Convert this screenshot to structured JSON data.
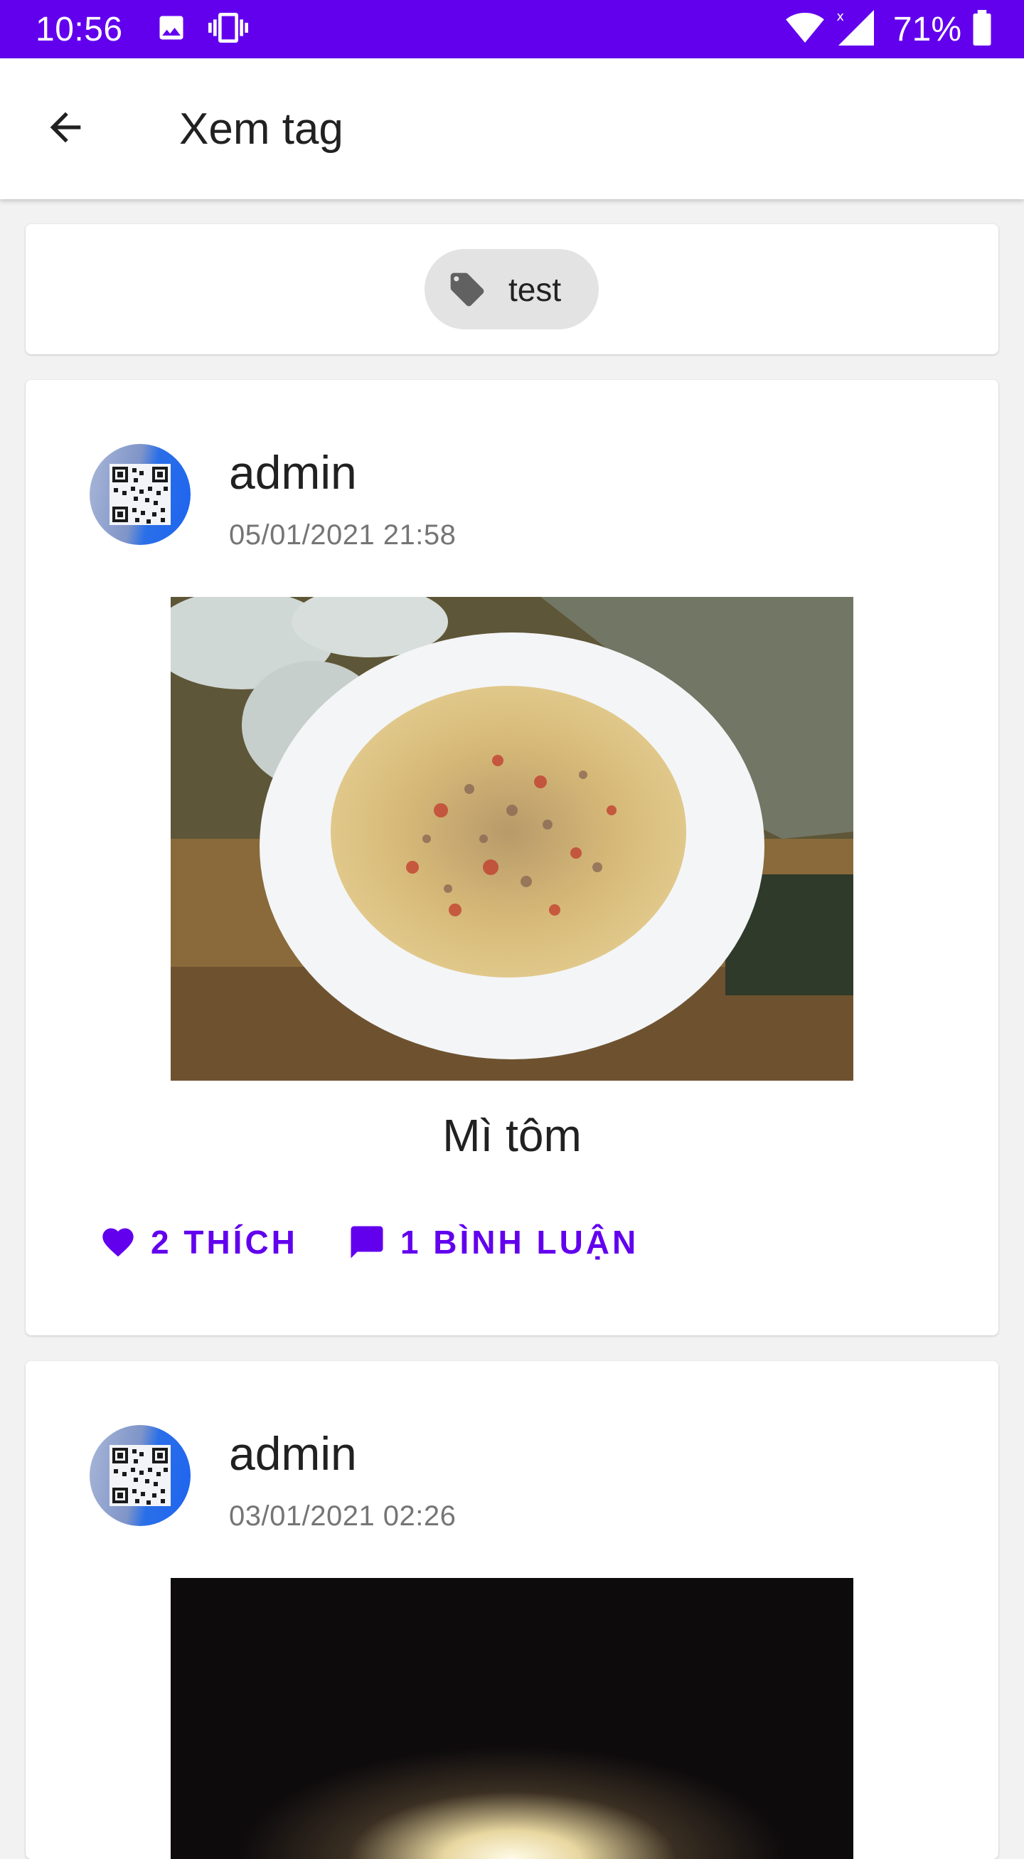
{
  "status_bar": {
    "time": "10:56",
    "battery": "71%",
    "background": "#6200ee",
    "icons": [
      "image-icon",
      "phone-vibrate-icon",
      "wifi-icon",
      "signal-icon",
      "battery-icon"
    ]
  },
  "app_bar": {
    "title": "Xem tag",
    "back_icon": "arrow-back-icon"
  },
  "tag": {
    "label": "test",
    "icon": "tag-icon"
  },
  "posts": [
    {
      "author": "admin",
      "timestamp": "05/01/2021 21:58",
      "title": "Mì tôm",
      "likes_label": "2 THÍCH",
      "comments_label": "1 BÌNH LUẬN"
    },
    {
      "author": "admin",
      "timestamp": "03/01/2021 02:26"
    }
  ],
  "colors": {
    "accent": "#6200ee",
    "surface": "#ffffff",
    "background": "#f2f2f2"
  }
}
